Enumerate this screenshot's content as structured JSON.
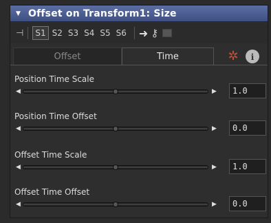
{
  "title": "Offset on Transform1: Size",
  "toolbar": {
    "slots": [
      "S1",
      "S2",
      "S3",
      "S4",
      "S5",
      "S6"
    ],
    "active_slot": "S1"
  },
  "tabs": {
    "offset": "Offset",
    "time": "Time",
    "info_glyph": "i"
  },
  "controls": [
    {
      "label": "Position Time Scale",
      "value": "1.0",
      "level": 0.5
    },
    {
      "label": "Position Time Offset",
      "value": "0.0",
      "level": 0.5
    },
    {
      "label": "Offset Time Scale",
      "value": "1.0",
      "level": 0.5
    },
    {
      "label": "Offset Time Offset",
      "value": "0.0",
      "level": 0.5
    }
  ]
}
